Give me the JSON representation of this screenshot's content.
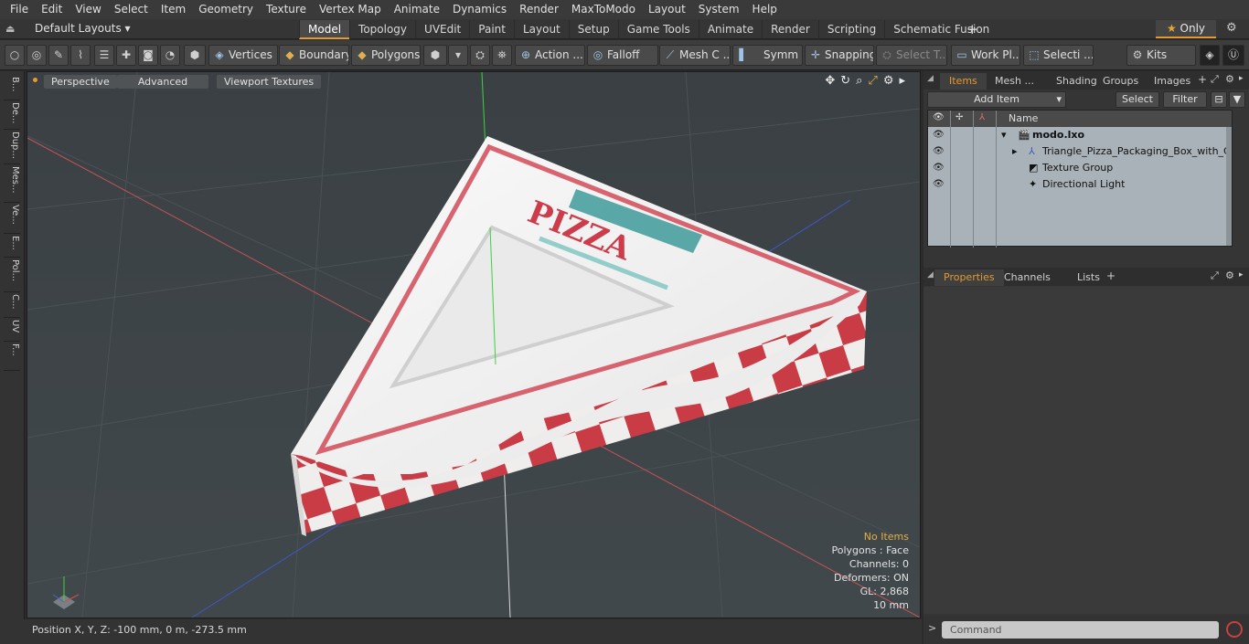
{
  "menu": [
    "File",
    "Edit",
    "View",
    "Select",
    "Item",
    "Geometry",
    "Texture",
    "Vertex Map",
    "Animate",
    "Dynamics",
    "Render",
    "MaxToModo",
    "Layout",
    "System",
    "Help"
  ],
  "layout": {
    "selector": "Default Layouts ▾",
    "tabs": [
      "Model",
      "Topology",
      "UVEdit",
      "Paint",
      "Layout",
      "Setup",
      "Game Tools",
      "Animate",
      "Render",
      "Scripting",
      "Schematic Fusion"
    ],
    "active_tab": "Model",
    "only_label": "Only"
  },
  "toolbar": {
    "vertices": "Vertices",
    "boundary": "Boundary",
    "polygons": "Polygons",
    "action": "Action ...",
    "falloff": "Falloff",
    "mesh": "Mesh C ...",
    "symm": "Symm ...",
    "snapping": "Snapping",
    "select_t": "Select T...",
    "work_pl": "Work Pl...",
    "selecti": "Selecti ...",
    "kits": "Kits"
  },
  "left_tabs": [
    "B...",
    "De...",
    "Dup...",
    "Mes...",
    "Ve...",
    "E...",
    "Pol...",
    "C...",
    "UV",
    "F..."
  ],
  "viewport": {
    "perspective": "Perspective",
    "advanced": "Advanced",
    "textures": "Viewport Textures",
    "model": {
      "brand": "PIZZA"
    },
    "stats": {
      "no_items": "No Items",
      "polygons": "Polygons : Face",
      "channels": "Channels: 0",
      "deformers": "Deformers: ON",
      "gl": "GL: 2,868",
      "units": "10 mm"
    }
  },
  "status": {
    "position": "Position X, Y, Z:   -100 mm, 0 m, -273.5 mm"
  },
  "items_panel": {
    "tabs": [
      "Items",
      "Mesh ...",
      "Shading",
      "Groups",
      "Images"
    ],
    "active_tab": "Items",
    "add_item": "Add Item",
    "select": "Select",
    "filter": "Filter",
    "name_col": "Name",
    "rows": [
      {
        "label": "modo.lxo"
      },
      {
        "label": "Triangle_Pizza_Packaging_Box_with_Cle..."
      },
      {
        "label": "Texture Group"
      },
      {
        "label": "Directional Light"
      }
    ]
  },
  "properties_panel": {
    "tabs": [
      "Properties",
      "Channels",
      "Lists"
    ],
    "active_tab": "Properties"
  },
  "command": {
    "placeholder": "Command"
  }
}
